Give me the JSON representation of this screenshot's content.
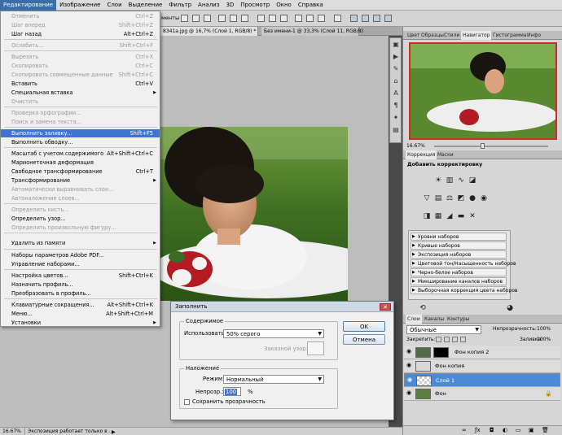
{
  "menubar": {
    "items": [
      "Редактирование",
      "Изображение",
      "Слои",
      "Выделение",
      "Фильтр",
      "Анализ",
      "3D",
      "Просмотр",
      "Окно",
      "Справка"
    ]
  },
  "tabs": {
    "doc1": "8341a.jpg @ 16,7% (Слой 1, RGB/8) *",
    "doc2": "Без имени-1 @ 33,3% (Слой 11, RGB/8)"
  },
  "optbar": {
    "label": "менты"
  },
  "edit_menu": {
    "items": [
      {
        "label": "Отменить",
        "shortcut": "Ctrl+Z",
        "disabled": true
      },
      {
        "label": "Шаг вперед",
        "shortcut": "Shift+Ctrl+Z",
        "disabled": true
      },
      {
        "label": "Шаг назад",
        "shortcut": "Alt+Ctrl+Z",
        "disabled": false
      },
      {
        "label": "Ослабить...",
        "shortcut": "Shift+Ctrl+F",
        "disabled": true
      },
      {
        "label": "Вырезать",
        "shortcut": "Ctrl+X",
        "disabled": true
      },
      {
        "label": "Скопировать",
        "shortcut": "Ctrl+C",
        "disabled": true
      },
      {
        "label": "Скопировать совмещенные данные",
        "shortcut": "Shift+Ctrl+C",
        "disabled": true
      },
      {
        "label": "Вставить",
        "shortcut": "Ctrl+V",
        "disabled": false
      },
      {
        "label": "Специальная вставка",
        "shortcut": "",
        "disabled": false,
        "submenu": true
      },
      {
        "label": "Очистить",
        "shortcut": "",
        "disabled": true
      },
      {
        "label": "Проверка орфографии...",
        "shortcut": "",
        "disabled": true
      },
      {
        "label": "Поиск и замена текста...",
        "shortcut": "",
        "disabled": true
      },
      {
        "label": "Выполнить заливку...",
        "shortcut": "Shift+F5",
        "disabled": false,
        "highlight": true
      },
      {
        "label": "Выполнить обводку...",
        "shortcut": "",
        "disabled": false
      },
      {
        "label": "Масштаб с учетом содержимого",
        "shortcut": "Alt+Shift+Ctrl+C",
        "disabled": false
      },
      {
        "label": "Марионеточная деформация",
        "shortcut": "",
        "disabled": false
      },
      {
        "label": "Свободное трансформирование",
        "shortcut": "Ctrl+T",
        "disabled": false
      },
      {
        "label": "Трансформирование",
        "shortcut": "",
        "disabled": false,
        "submenu": true
      },
      {
        "label": "Автоматически выравнивать слои...",
        "shortcut": "",
        "disabled": true
      },
      {
        "label": "Автоналожение слоев...",
        "shortcut": "",
        "disabled": true
      },
      {
        "label": "Определить кисть...",
        "shortcut": "",
        "disabled": true
      },
      {
        "label": "Определить узор...",
        "shortcut": "",
        "disabled": false
      },
      {
        "label": "Определить произвольную фигуру...",
        "shortcut": "",
        "disabled": true
      },
      {
        "label": "Удалить из памяти",
        "shortcut": "",
        "disabled": false,
        "submenu": true
      },
      {
        "label": "Наборы параметров Adobe PDF...",
        "shortcut": "",
        "disabled": false
      },
      {
        "label": "Управление наборами...",
        "shortcut": "",
        "disabled": false
      },
      {
        "label": "Настройка цветов...",
        "shortcut": "Shift+Ctrl+K",
        "disabled": false
      },
      {
        "label": "Назначить профиль...",
        "shortcut": "",
        "disabled": false
      },
      {
        "label": "Преобразовать в профиль...",
        "shortcut": "",
        "disabled": false
      },
      {
        "label": "Клавиатурные сокращения...",
        "shortcut": "Alt+Shift+Ctrl+K",
        "disabled": false
      },
      {
        "label": "Меню...",
        "shortcut": "Alt+Shift+Ctrl+M",
        "disabled": false
      },
      {
        "label": "Установки",
        "shortcut": "",
        "disabled": false,
        "submenu": true
      }
    ]
  },
  "dialog": {
    "title": "Заполнить",
    "content_group": "Содержимое",
    "use_label": "Использовать:",
    "use_value": "50% серого",
    "pattern_label": "Заказной узор:",
    "blend_group": "Наложение",
    "mode_label": "Режим:",
    "mode_value": "Нормальный",
    "opacity_label": "Непрозр.:",
    "opacity_value": "100",
    "opacity_unit": "%",
    "preserve_label": "Сохранить прозрачность",
    "ok_label": "OK",
    "cancel_label": "Отмена"
  },
  "navigator": {
    "tabs": [
      "Цвет",
      "Образцы",
      "Стили",
      "Навигатор",
      "Гистограмма",
      "Инфо"
    ],
    "zoom": "16.67%"
  },
  "adjustments": {
    "tabs": [
      "Коррекция",
      "Маски"
    ],
    "heading": "Добавить корректировку",
    "presets": [
      "Уровни наборов",
      "Кривые наборов",
      "Экспозиция наборов",
      "Цветовой тон/Насыщенность наборов",
      "Черно-белое наборов",
      "Микширование каналов наборов",
      "Выборочная коррекция цвета наборов"
    ]
  },
  "layers": {
    "tabs": [
      "Слои",
      "Каналы",
      "Контуры"
    ],
    "blend_mode": "Обычные",
    "opacity_label": "Непрозрачность:",
    "opacity_value": "100%",
    "lock_label": "Закрепить:",
    "fill_label": "Заливка:",
    "fill_value": "100%",
    "items": [
      "Фон копия 2",
      "Фон копия",
      "Слой 1",
      "Фон"
    ]
  },
  "status": {
    "zoom": "16.67%",
    "text": "Экспозиция работает только в ..."
  },
  "colors": {
    "highlight": "#3f74d0",
    "layer_selected": "#4a8ad6",
    "dialog_title": "#cfd9e4"
  }
}
